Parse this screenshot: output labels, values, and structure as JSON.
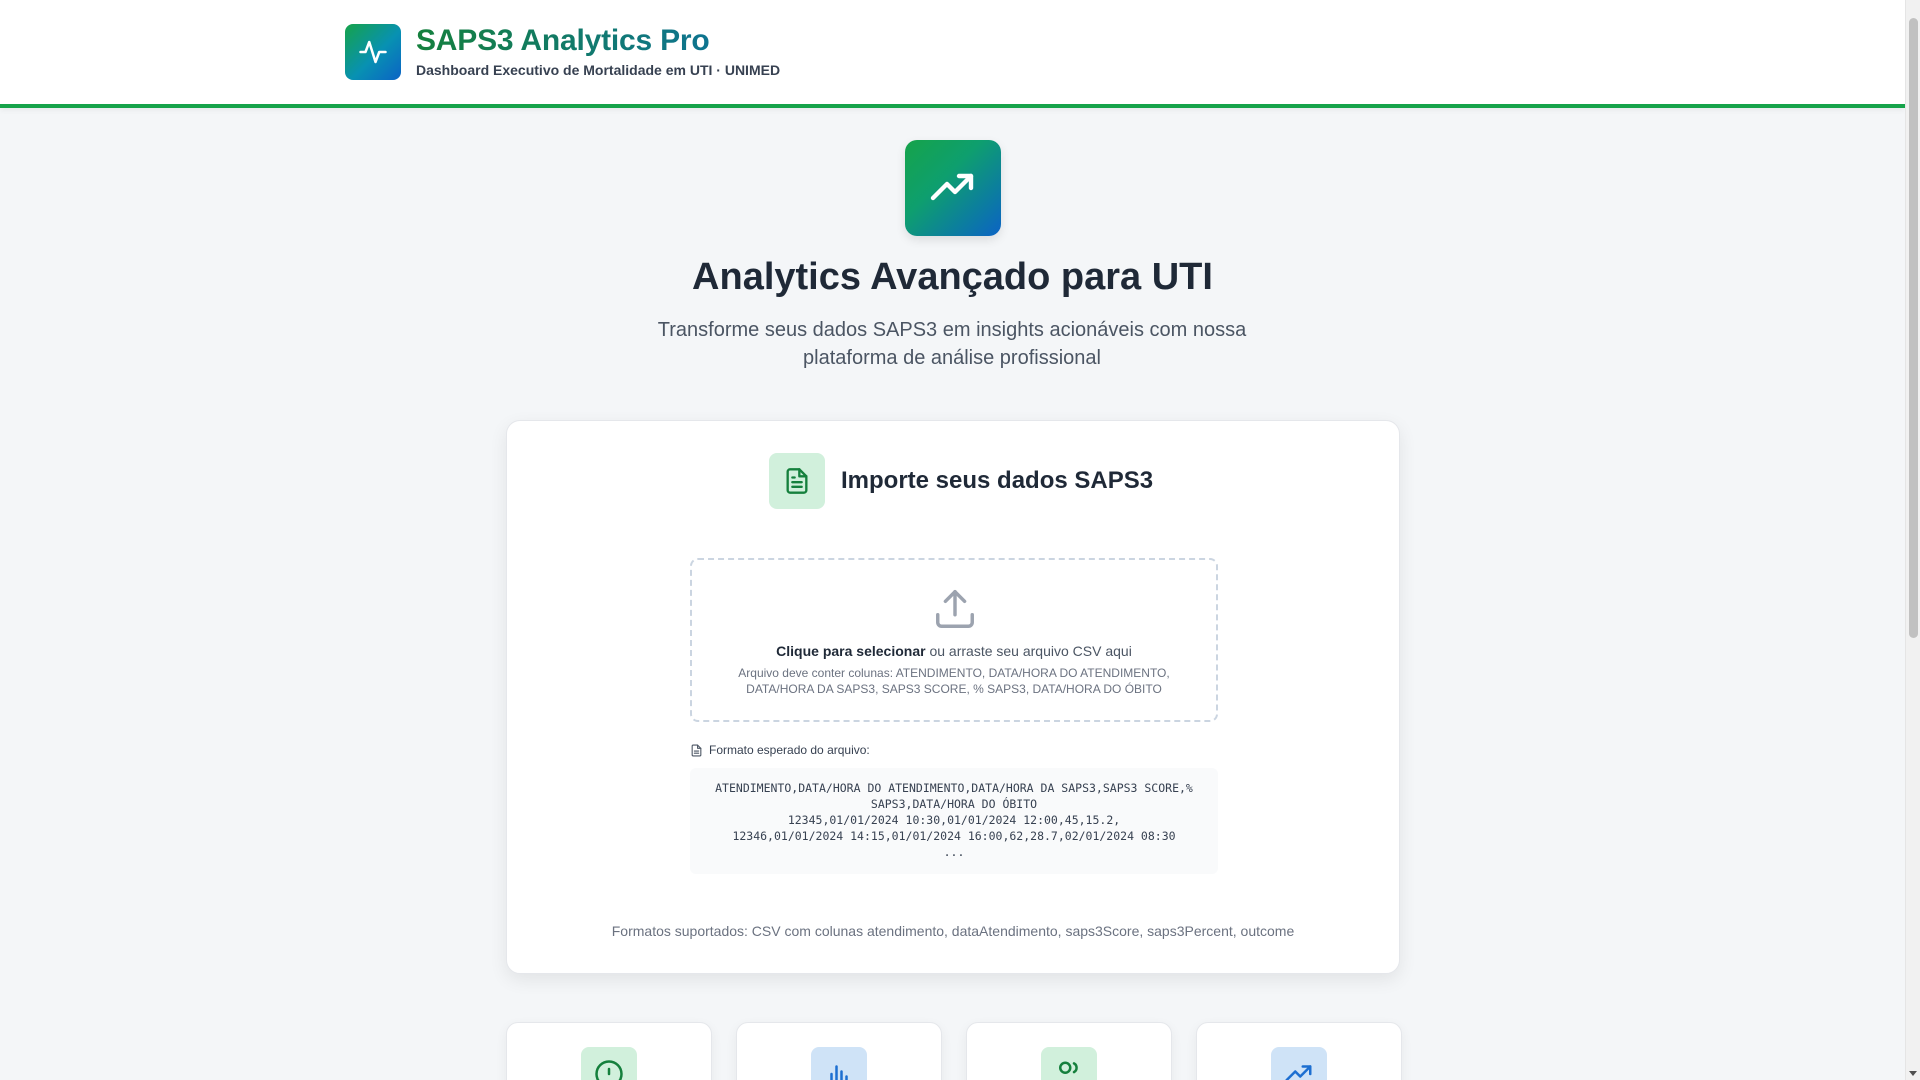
{
  "header": {
    "title": "SAPS3 Analytics Pro",
    "subtitle": "Dashboard Executivo de Mortalidade em UTI · UNIMED",
    "logo_icon": "activity-pulse-icon"
  },
  "hero": {
    "icon": "trending-up-icon",
    "title": "Analytics Avançado para UTI",
    "description": "Transforme seus dados SAPS3 em insights acionáveis com nossa plataforma de análise profissional"
  },
  "import_card": {
    "icon": "file-text-icon",
    "title": "Importe seus dados SAPS3",
    "dropzone": {
      "icon": "upload-icon",
      "action_bold": "Clique para selecionar",
      "action_rest": " ou arraste seu arquivo CSV aqui",
      "note": "Arquivo deve conter colunas: ATENDIMENTO, DATA/HORA DO ATENDIMENTO, DATA/HORA DA SAPS3, SAPS3 SCORE, % SAPS3, DATA/HORA DO ÓBITO"
    },
    "format_label": "Formato esperado do arquivo:",
    "code_lines": [
      "ATENDIMENTO,DATA/HORA DO ATENDIMENTO,DATA/HORA DA SAPS3,SAPS3 SCORE,%",
      "SAPS3,DATA/HORA DO ÓBITO",
      "12345,01/01/2024 10:30,01/01/2024 12:00,45,15.2,",
      "12346,01/01/2024 14:15,01/01/2024 16:00,62,28.7,02/01/2024 08:30",
      "..."
    ],
    "supported": "Formatos suportados: CSV com colunas atendimento, dataAtendimento, saps3Score, saps3Percent, outcome"
  },
  "feature_cards": [
    {
      "icon": "alert-circle-icon",
      "tone": "green"
    },
    {
      "icon": "bar-chart-icon",
      "tone": "blue"
    },
    {
      "icon": "users-icon",
      "tone": "green"
    },
    {
      "icon": "trending-up-icon",
      "tone": "blue"
    }
  ],
  "colors": {
    "accent_green": "#16a34a",
    "accent_blue": "#0b63c5",
    "background": "#f4f6f8"
  }
}
